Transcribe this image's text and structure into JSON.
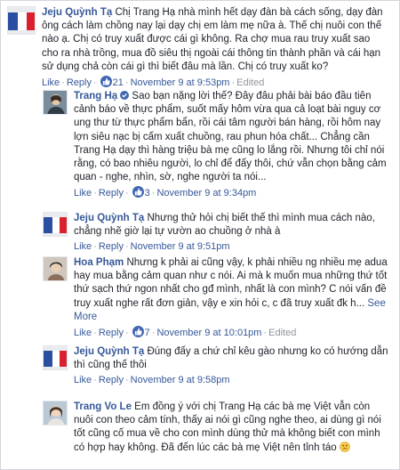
{
  "comments": [
    {
      "author": "Jeju Quỳnh Tạ",
      "text": "Chị Trang Hạ nhà mình hết dạy đàn bà cách sống, dạy đàn ông cách làm chồng nay lại dạy chị em làm mẹ nữa à. Thế chị nuôi con thế nào ạ. Chị có truy xuất được cái gì không. Ra chợ mua rau truy xuất sao cho ra nhà trồng, mua đồ siêu thị ngoài cái thông tin thành phần và cái hạn sử dụng chả còn cái gì thì biết đâu mà lần. Chị có truy xuất ko?",
      "like": "Like",
      "reply": "Reply",
      "reactions": "21",
      "time": "November 9 at 9:53pm",
      "edited": "Edited"
    },
    {
      "author": "Trang Hạ",
      "text": "Sao bạn nặng lời thế? Đây đâu phải bài báo đầu tiên cảnh báo về thực phẩm, suốt mấy hôm vừa qua cả loạt bài nguy cơ ung thư từ thực phẩm bẩn, rồi cái tâm người bán hàng, rồi hôm nay lợn siêu nạc bị cấm xuất chuồng, rau phun hóa chất... Chẳng cần Trang Hạ dạy thì hàng triệu bà mẹ cũng lo lắng rồi. Nhưng tôi chỉ nói rằng, có bao nhiêu người, lo chỉ để đấy thôi, chứ vẫn chọn bằng cảm quan - nghe, nhìn, sờ, nghe người ta nói...",
      "like": "Like",
      "reply": "Reply",
      "reactions": "3",
      "time": "November 9 at 9:34pm"
    },
    {
      "author": "Jeju Quỳnh Tạ",
      "text": "Nhưng thử hỏi chị biết thế thì mình mua cách nào, chẳng nhẽ giờ lại tự vườn ao chuồng ở nhà à",
      "like": "Like",
      "reply": "Reply",
      "time": "November 9 at 9:51pm"
    },
    {
      "author": "Hoa Phạm",
      "text": "Nhưng k phải ai cũng vậy, k phải nhiều ng nhiều mẹ adua hay mua bằng cảm quan như c nói. Ai mà k muốn mua những thứ tốt thứ sạch thứ ngon nhất cho gđ mình, nhất là con mình? C nói vấn đề truy xuất nghe rất đơn giản, vậy e xin hỏi c, c đã truy xuất đk h...",
      "see_more": "See More",
      "like": "Like",
      "reply": "Reply",
      "reactions": "7",
      "time": "November 9 at 10:01pm",
      "edited": "Edited"
    },
    {
      "author": "Jeju Quỳnh Tạ",
      "text": "Đúng đấy a chứ chỉ kêu gào nhưng ko có hướng dẫn thì cũng thế thôi",
      "like": "Like",
      "reply": "Reply",
      "time": "November 9 at 9:58pm"
    },
    {
      "author": "Trang Vo Le",
      "text": "Em đồng ý với chị Trang Hạ các bà mẹ Việt vẫn còn nuôi con theo cảm tính, thấy ai nói gì cũng nghe theo, ai dùng gì nói tốt cũng cố mua về cho con mình dùng thử mà không biết con mình có hợp hay không. Đã đến lúc các bà mẹ Việt nên tỉnh táo"
    }
  ],
  "colors": {
    "link": "#365899",
    "meta": "#90949c",
    "like_badge": "#4267b2",
    "border": "#d3d6db"
  }
}
